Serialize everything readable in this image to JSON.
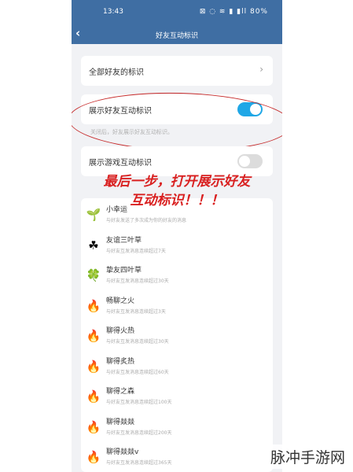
{
  "status_bar": {
    "time": "13:43",
    "icons": "⊠ ◌ ≋ ▮ ▮ll",
    "battery": "80%"
  },
  "nav": {
    "back_icon": "chevron-left-icon",
    "title": "好友互动标识"
  },
  "settings": {
    "all_friends_label": "全部好友的标识",
    "show_friend_label": "展示好友互动标识",
    "show_friend_enabled": true,
    "hint": "关闭后，好友展示好友互动标识。",
    "show_game_label": "展示游戏互动标识",
    "show_game_enabled": false
  },
  "annotation": {
    "line1": "最后一步，打开展示好友",
    "line2": "互动标识！！！",
    "color": "#d92020"
  },
  "badges": [
    {
      "name": "小幸运",
      "desc": "与好友发送了多次成为你的好友的消息",
      "icon": "sprout-icon",
      "glyph": "🌱"
    },
    {
      "name": "友谊三叶草",
      "desc": "与好友互发消息连续超过7天",
      "icon": "three-leaf-clover-icon",
      "glyph": "☘"
    },
    {
      "name": "挚友四叶草",
      "desc": "与好友互发消息连续超过30天",
      "icon": "four-leaf-clover-icon",
      "glyph": "🍀"
    },
    {
      "name": "畅聊之火",
      "desc": "与好友互发消息连续超过3天",
      "icon": "small-flame-icon",
      "glyph": "🔥"
    },
    {
      "name": "聊得火热",
      "desc": "与好友互发消息连续超过30天",
      "icon": "flame-icon",
      "glyph": "🔥"
    },
    {
      "name": "聊得炙热",
      "desc": "与好友互发消息连续超过60天",
      "icon": "hot-flame-icon",
      "glyph": "🔥"
    },
    {
      "name": "聊得之森",
      "desc": "与好友互发消息连续超过100天",
      "icon": "flame-forest-icon",
      "glyph": "🔥"
    },
    {
      "name": "聊得燚燚",
      "desc": "与好友互发消息连续超过200天",
      "icon": "blazing-flame-icon",
      "glyph": "🔥"
    },
    {
      "name": "聊得燚燚v",
      "desc": "与好友互发消息连续超过365天",
      "icon": "purple-flame-icon",
      "glyph": "🔥"
    }
  ],
  "watermark": "脉冲手游网"
}
